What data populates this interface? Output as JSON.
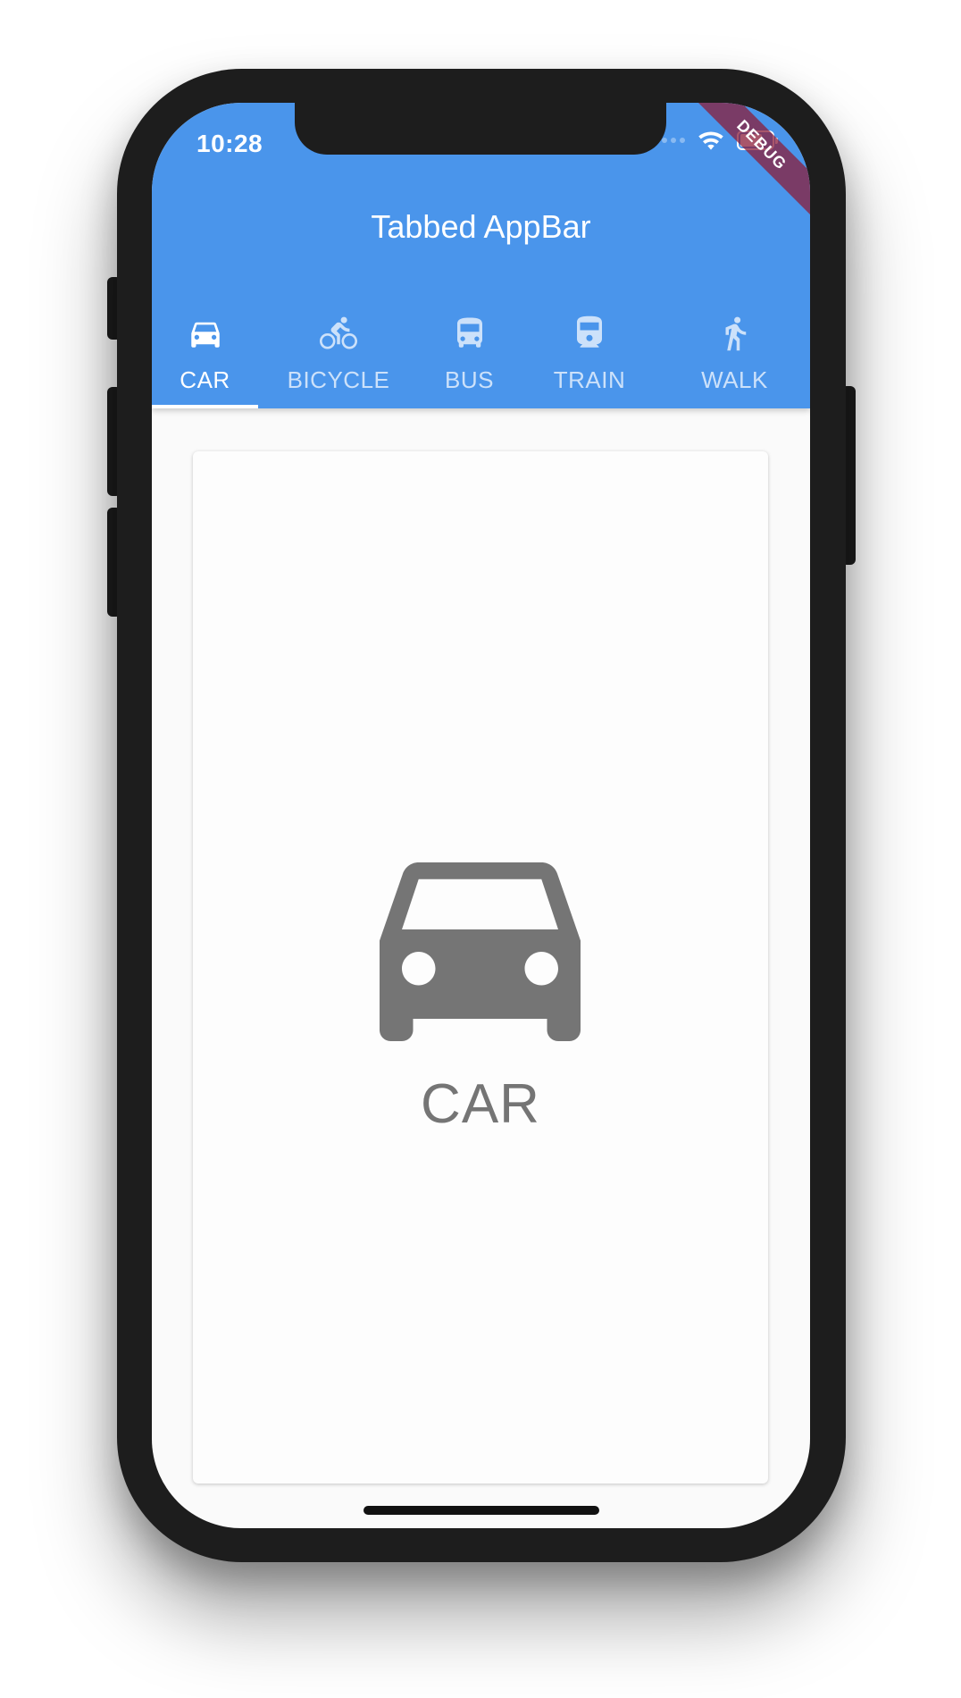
{
  "status_bar": {
    "time": "10:28"
  },
  "debug_banner": "DEBUG",
  "appbar": {
    "title": "Tabbed AppBar",
    "background_color": "#4a95eb"
  },
  "tabs": [
    {
      "label": "CAR",
      "icon": "car-icon",
      "active": true
    },
    {
      "label": "BICYCLE",
      "icon": "bicycle-icon",
      "active": false
    },
    {
      "label": "BUS",
      "icon": "bus-icon",
      "active": false
    },
    {
      "label": "TRAIN",
      "icon": "train-icon",
      "active": false
    },
    {
      "label": "WALK",
      "icon": "walk-icon",
      "active": false
    }
  ],
  "content": {
    "icon": "car-icon",
    "label": "CAR",
    "icon_color": "#757575"
  }
}
